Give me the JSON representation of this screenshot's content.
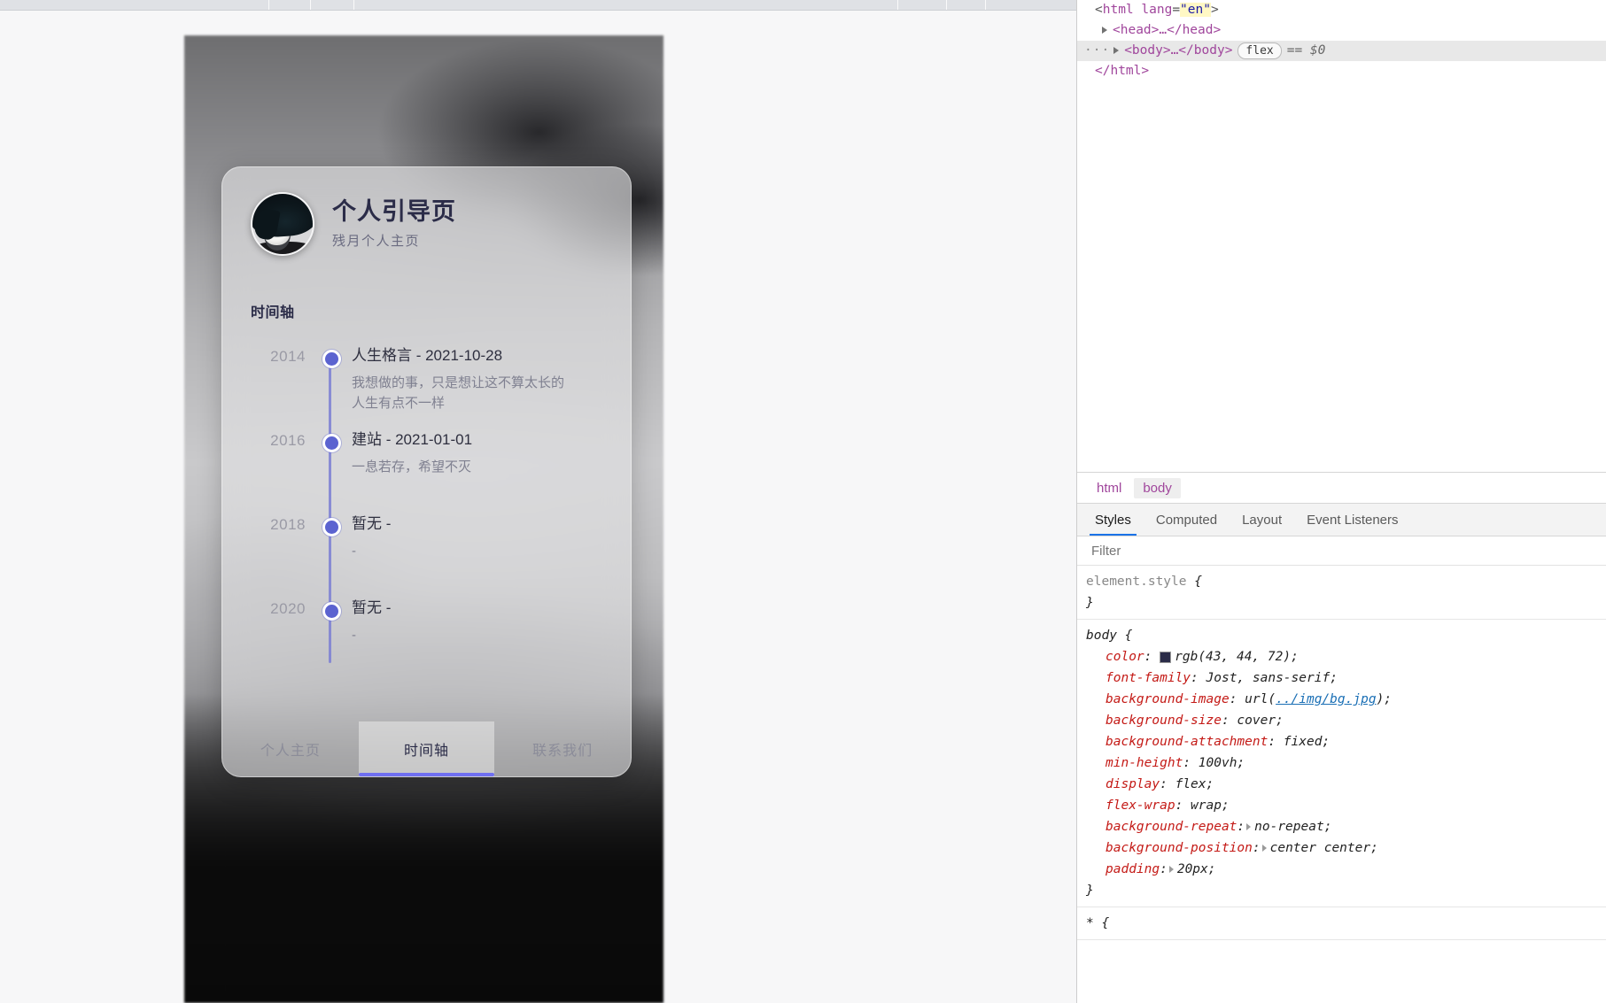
{
  "viewport": {
    "profile": {
      "title": "个人引导页",
      "subtitle": "残月个人主页",
      "avatar_alt": "avatar"
    },
    "timeline_heading": "时间轴",
    "timeline": [
      {
        "year": "2014",
        "title": "人生格言 - 2021-10-28",
        "desc": "我想做的事，只是想让这不算太长的\n人生有点不一样"
      },
      {
        "year": "2016",
        "title": "建站 - 2021-01-01",
        "desc": "一息若存，希望不灭"
      },
      {
        "year": "2018",
        "title": "暂无 -",
        "desc": "-"
      },
      {
        "year": "2020",
        "title": "暂无 -",
        "desc": "-"
      }
    ],
    "tabs": [
      {
        "label": "个人主页",
        "active": false
      },
      {
        "label": "时间轴",
        "active": true
      },
      {
        "label": "联系我们",
        "active": false
      }
    ],
    "accent_color": "#6f6ff0",
    "dot_color": "#5b63d0",
    "title_color": "#2b2c48"
  },
  "devtools": {
    "dom": {
      "line_html_open": "<html lang=\"en\">",
      "line_html_tag": "html",
      "line_html_attr_name": "lang",
      "line_html_attr_value": "\"en\"",
      "line_head": "<head>…</head>",
      "line_body": "<body>…</body>",
      "body_badge": "flex",
      "body_selected_marker": "== $0",
      "line_html_close": "</html>",
      "ellipsis": "···"
    },
    "breadcrumb": [
      {
        "label": "html",
        "active": false
      },
      {
        "label": "body",
        "active": true
      }
    ],
    "panel_tabs": [
      {
        "label": "Styles",
        "active": true
      },
      {
        "label": "Computed",
        "active": false
      },
      {
        "label": "Layout",
        "active": false
      },
      {
        "label": "Event Listeners",
        "active": false
      }
    ],
    "filter_placeholder": "Filter",
    "rules": [
      {
        "selector": "element.style",
        "selector_muted": true,
        "declarations": []
      },
      {
        "selector": "body",
        "selector_muted": false,
        "declarations": [
          {
            "property": "color",
            "value": "rgb(43, 44, 72)",
            "swatch": "rgb(43, 44, 72)"
          },
          {
            "property": "font-family",
            "value": "Jost, sans-serif"
          },
          {
            "property": "background-image",
            "value": "url(",
            "link": "../img/bg.jpg",
            "value_tail": ");"
          },
          {
            "property": "background-size",
            "value": "cover"
          },
          {
            "property": "background-attachment",
            "value": "fixed"
          },
          {
            "property": "min-height",
            "value": "100vh"
          },
          {
            "property": "display",
            "value": "flex"
          },
          {
            "property": "flex-wrap",
            "value": "wrap"
          },
          {
            "property": "background-repeat",
            "value": "no-repeat",
            "expandable": true
          },
          {
            "property": "background-position",
            "value": "center center",
            "expandable": true
          },
          {
            "property": "padding",
            "value": "20px",
            "expandable": true
          }
        ]
      },
      {
        "selector": "*",
        "selector_muted": false,
        "declarations": []
      }
    ]
  }
}
